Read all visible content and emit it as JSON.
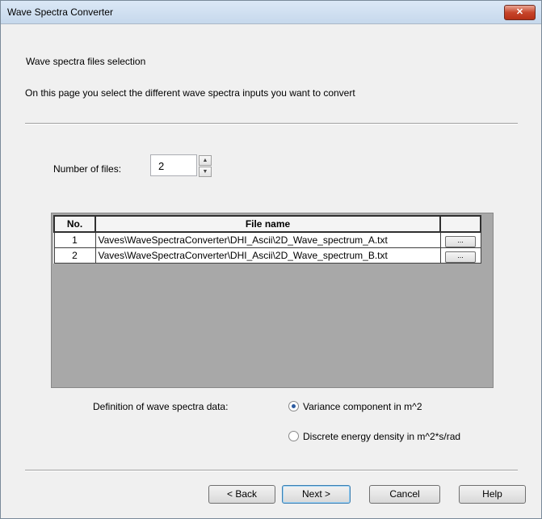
{
  "window": {
    "title": "Wave Spectra Converter",
    "close_label": "✕"
  },
  "page": {
    "heading": "Wave spectra files selection",
    "description": "On this page you select the different wave spectra inputs you want to convert"
  },
  "number_of_files": {
    "label": "Number of files:",
    "value": "2",
    "spin_up": "▲",
    "spin_down": "▼"
  },
  "grid": {
    "headers": {
      "no": "No.",
      "file_name": "File name",
      "browse": ""
    },
    "rows": [
      {
        "no": "1",
        "file": "Vaves\\WaveSpectraConverter\\DHI_Ascii\\2D_Wave_spectrum_A.txt",
        "browse": "..."
      },
      {
        "no": "2",
        "file": "Vaves\\WaveSpectraConverter\\DHI_Ascii\\2D_Wave_spectrum_B.txt",
        "browse": "..."
      }
    ]
  },
  "definition": {
    "label": "Definition of wave spectra data:",
    "options": [
      {
        "label": "Variance component in m^2",
        "selected": true
      },
      {
        "label": "Discrete energy density in m^2*s/rad",
        "selected": false
      }
    ]
  },
  "buttons": {
    "back": "< Back",
    "next": "Next >",
    "cancel": "Cancel",
    "help": "Help"
  }
}
